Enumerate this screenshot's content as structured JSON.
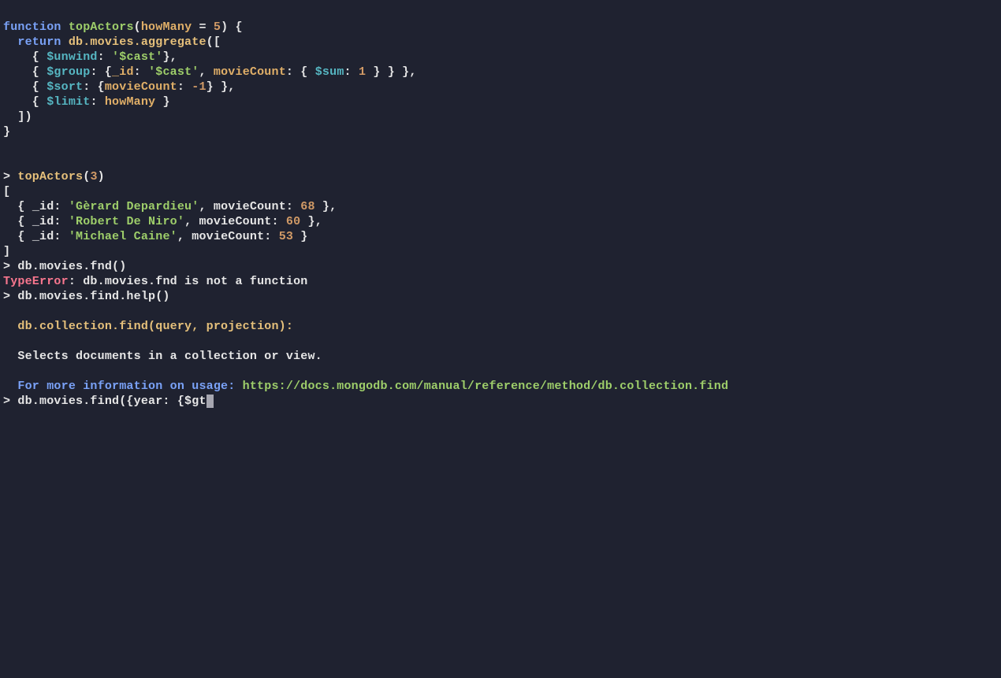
{
  "fn": {
    "keyword": "function",
    "name": "topActors",
    "param": "howMany",
    "eq": " = ",
    "default": "5",
    "sigEnd": ") {",
    "returnKw": "return",
    "dbAgg": "db.movies.aggregate",
    "aggOpen": "([",
    "unwind": "$unwind",
    "castStr": "'$cast'",
    "group": "$group",
    "idKey": "_id",
    "movieCountKey": "movieCount",
    "sum": "$sum",
    "one": "1",
    "sort": "$sort",
    "negOne": "-1",
    "limit": "$limit",
    "howManyRef": "howMany",
    "aggClose": "])",
    "fnClose": "}"
  },
  "call": {
    "prompt": "> ",
    "fn": "topActors",
    "open": "(",
    "arg": "3",
    "close": ")"
  },
  "results": {
    "open": "[",
    "rowPrefixId": "_id",
    "rowPrefixMc": "movieCount",
    "colon": ": ",
    "items": [
      {
        "name": "'Gèrard Depardieu'",
        "count": "68"
      },
      {
        "name": "'Robert De Niro'",
        "count": "60"
      },
      {
        "name": "'Michael Caine'",
        "count": "53"
      }
    ],
    "close": "]"
  },
  "fndCall": {
    "prompt": "> ",
    "text": "db.movies.fnd()"
  },
  "error": {
    "label": "TypeError",
    "msg": ": db.movies.fnd is not a function"
  },
  "helpCall": {
    "prompt": "> ",
    "text": "db.movies.find.help()"
  },
  "help": {
    "sigPrefix": "db.collection.find",
    "sigArgs": "(query, projection)",
    "sigColon": ":",
    "desc": "Selects documents in a collection or view.",
    "moreInfo": "For more information on usage:",
    "url": "https://docs.mongodb.com/manual/reference/method/db.collection.find"
  },
  "input": {
    "prompt": "> ",
    "text": "db.movies.find({year: {$gt"
  }
}
